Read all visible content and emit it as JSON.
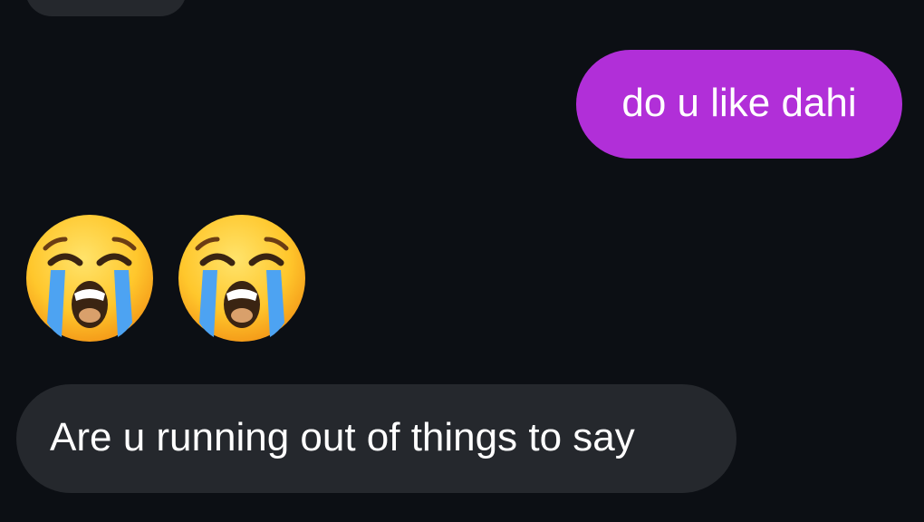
{
  "messages": {
    "previous_incoming": "",
    "outgoing_1": "do u like dahi",
    "emoji_reply": {
      "count": 2,
      "icon": "loudly-crying-face-icon"
    },
    "incoming_1": "Are u running out of things to say"
  },
  "colors": {
    "background": "#0c0f14",
    "outgoing_bubble": "#b12fd8",
    "incoming_bubble": "#25282d",
    "text": "#ffffff"
  }
}
